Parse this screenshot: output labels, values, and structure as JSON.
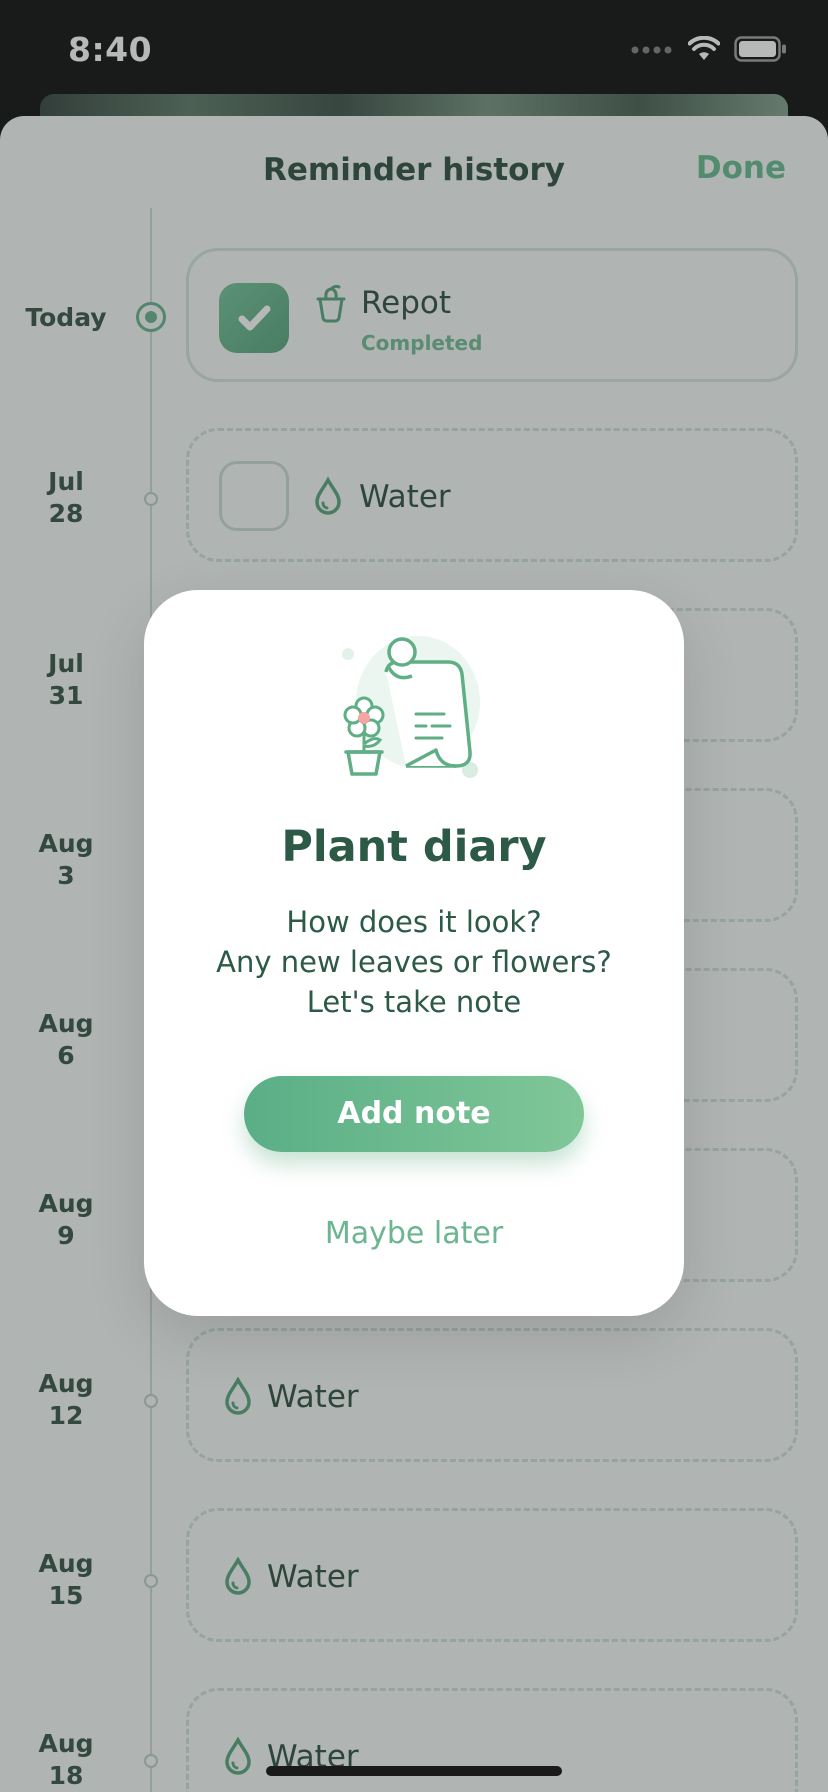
{
  "status_bar": {
    "time": "8:40"
  },
  "header": {
    "title": "Reminder history",
    "done_label": "Done"
  },
  "timeline": [
    {
      "date": "Today",
      "task": "Repot",
      "status": "Completed",
      "icon": "pot-icon",
      "checkbox": "checked"
    },
    {
      "date": "Jul\n28",
      "task": "Water",
      "icon": "water-drop-icon",
      "checkbox": "unchecked"
    },
    {
      "date": "Jul\n31"
    },
    {
      "date": "Aug\n3"
    },
    {
      "date": "Aug\n6"
    },
    {
      "date": "Aug\n9"
    },
    {
      "date": "Aug\n12",
      "task": "Water",
      "icon": "water-drop-icon"
    },
    {
      "date": "Aug\n15",
      "task": "Water",
      "icon": "water-drop-icon"
    },
    {
      "date": "Aug\n18",
      "task": "Water",
      "icon": "water-drop-icon"
    }
  ],
  "modal": {
    "title": "Plant diary",
    "body": "How does it look?\nAny new leaves or flowers?\nLet's take note",
    "primary_button": "Add note",
    "secondary_button": "Maybe later",
    "illustration": "plant-diary-illustration"
  },
  "colors": {
    "accent": "#5fae86",
    "text_dark": "#234536",
    "title_green": "#2c5a46"
  }
}
